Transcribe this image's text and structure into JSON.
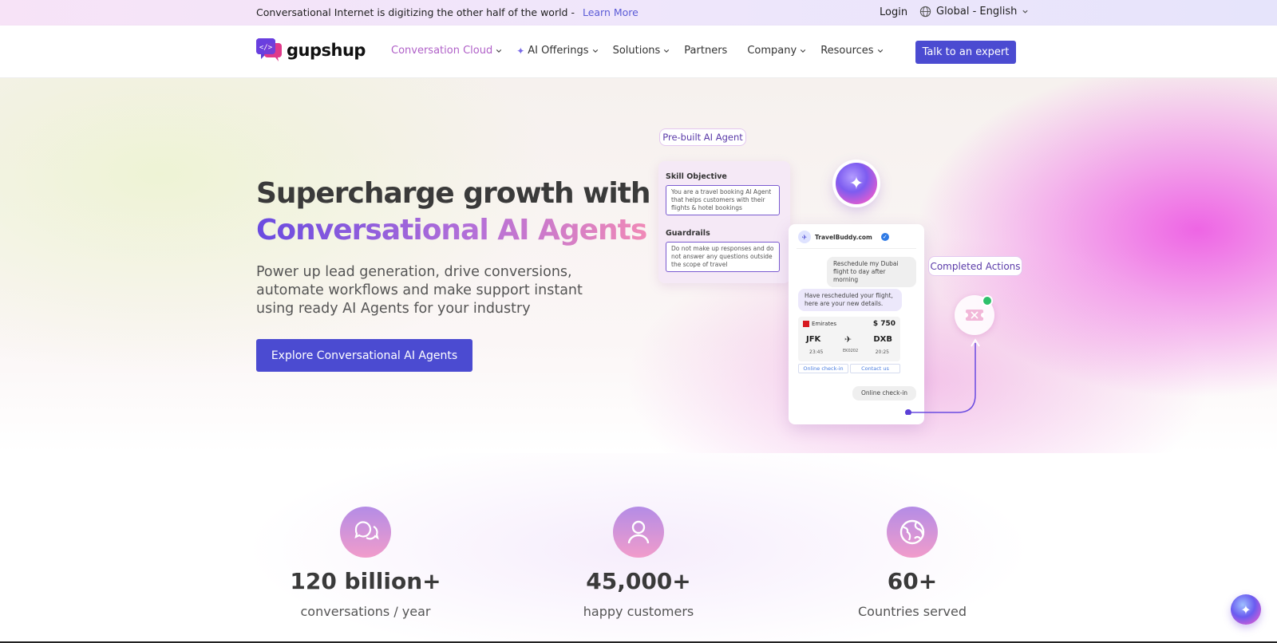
{
  "topbar": {
    "message": "Conversational Internet is digitizing the other half of the world -",
    "learn_more": "Learn More",
    "login": "Login",
    "language": "Global - English"
  },
  "nav": {
    "brand": "gupshup",
    "items": [
      {
        "label": "Conversation Cloud",
        "has_dropdown": true,
        "active": true
      },
      {
        "label": "AI Offerings",
        "has_dropdown": true,
        "active": false
      },
      {
        "label": "Solutions",
        "has_dropdown": true,
        "active": false
      },
      {
        "label": "Partners",
        "has_dropdown": false,
        "active": false
      },
      {
        "label": "Company",
        "has_dropdown": true,
        "active": false
      },
      {
        "label": "Resources",
        "has_dropdown": true,
        "active": false
      }
    ],
    "cta": "Talk to an expert"
  },
  "hero": {
    "title_line1": "Supercharge growth with",
    "title_line2": "Conversational AI Agents",
    "subtitle": "Power up lead generation, drive conversions, automate workflows and make support instant using ready AI Agents for your industry",
    "cta": "Explore Conversational AI Agents"
  },
  "illustration": {
    "tag_prebuilt": "Pre-built AI Agent",
    "tag_completed": "Completed Actions",
    "skill_label": "Skill Objective",
    "skill_text": "You are a travel booking AI Agent that helps customers with their flights & hotel bookings",
    "guardrails_label": "Guardrails",
    "guardrails_text": "Do not make up responses and do not answer any questions outside the scope of travel",
    "chat_name": "TravelBuddy.com",
    "msg_user_1": "Reschedule my Dubai flight to day after morning",
    "msg_bot_1": "Have rescheduled your flight, here are your new details.",
    "airline": "Emirates",
    "price": "$ 750",
    "from_code": "JFK",
    "to_code": "DXB",
    "dep_time": "23:45",
    "arr_time": "20:25",
    "flight_code": "EK0202",
    "link_checkin": "Online check-in",
    "link_contact": "Contact us",
    "msg_user_2": "Online check-in"
  },
  "stats": [
    {
      "icon": "chat-bubbles-icon",
      "value": "120 billion+",
      "label": "conversations / year"
    },
    {
      "icon": "user-icon",
      "value": "45,000+",
      "label": "happy customers"
    },
    {
      "icon": "globe-icon",
      "value": "60+",
      "label": "Countries served"
    }
  ],
  "colors": {
    "primary": "#4b4bd1",
    "accent_pink": "#e45cd0",
    "active_nav": "#b061c8"
  }
}
